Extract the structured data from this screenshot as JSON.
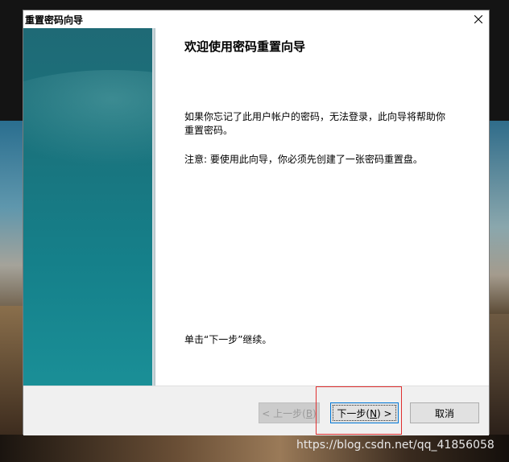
{
  "window": {
    "title": "重置密码向导"
  },
  "content": {
    "heading": "欢迎使用密码重置向导",
    "intro_line1": "如果你忘记了此用户帐户的密码，无法登录，此向导将帮助你",
    "intro_line2": "重置密码。",
    "note": "注意: 要使用此向导，你必须先创建了一张密码重置盘。",
    "continue_text": "单击“下一步”继续。"
  },
  "buttons": {
    "back": {
      "prefix": "< 上一步(",
      "key": "B",
      "suffix": ")"
    },
    "next": {
      "prefix": "下一步(",
      "key": "N",
      "suffix": ") >"
    },
    "cancel": "取消"
  },
  "watermark": "https://blog.csdn.net/qq_41856058",
  "colors": {
    "accent": "#0078d7",
    "side_panel": "#15808a",
    "highlight": "#e03030"
  },
  "icons": {
    "close": "close-icon"
  }
}
